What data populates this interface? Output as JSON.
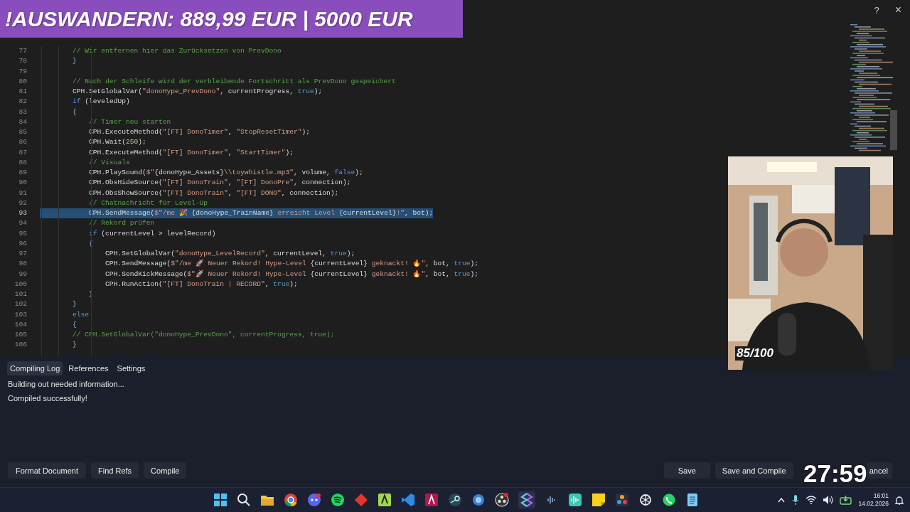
{
  "overlay": {
    "banner": "!AUSWANDERN: 889,99 EUR | 5000 EUR",
    "timer": "27:59",
    "webcam_counter": "85/100"
  },
  "window": {
    "help": "?",
    "close": "×"
  },
  "editor": {
    "lines": [
      {
        "number": "77",
        "selected": false,
        "tokens": [
          {
            "kind": "comment",
            "text": "        // Wir entfernen hier das Zurücksetzen von PrevDono"
          }
        ]
      },
      {
        "number": "78",
        "selected": false,
        "tokens": [
          {
            "kind": "brace",
            "text": "        }"
          }
        ]
      },
      {
        "number": "79",
        "selected": false
      },
      {
        "number": "80",
        "selected": false,
        "tokens": [
          {
            "kind": "comment",
            "text": "        // Nach der Schleife wird der verbleibende Fortschritt als PrevDono gespeichert"
          }
        ]
      },
      {
        "number": "81",
        "selected": false,
        "tokens": [
          {
            "kind": "plain",
            "text": "        CPH.SetGlobalVar("
          },
          {
            "kind": "string",
            "text": "\"donoHype_PrevDono\""
          },
          {
            "kind": "plain",
            "text": ", currentProgress, "
          },
          {
            "kind": "keyword",
            "text": "true"
          },
          {
            "kind": "plain",
            "text": ");"
          }
        ]
      },
      {
        "number": "82",
        "selected": false,
        "tokens": [
          {
            "kind": "keyword",
            "text": "        if"
          },
          {
            "kind": "plain",
            "text": " (leveledUp)"
          }
        ]
      },
      {
        "number": "83",
        "selected": false,
        "tokens": [
          {
            "kind": "brace",
            "text": "        {"
          }
        ]
      },
      {
        "number": "84",
        "selected": false,
        "tokens": [
          {
            "kind": "comment",
            "text": "            // Timer neu starten"
          }
        ]
      },
      {
        "number": "85",
        "selected": false,
        "tokens": [
          {
            "kind": "plain",
            "text": "            CPH.ExecuteMethod("
          },
          {
            "kind": "string",
            "text": "\"[FT] DonoTimer\""
          },
          {
            "kind": "plain",
            "text": ", "
          },
          {
            "kind": "string",
            "text": "\"StopResetTimer\""
          },
          {
            "kind": "plain",
            "text": ");"
          }
        ]
      },
      {
        "number": "86",
        "selected": false,
        "tokens": [
          {
            "kind": "plain",
            "text": "            CPH.Wait("
          },
          {
            "kind": "number",
            "text": "250"
          },
          {
            "kind": "plain",
            "text": ");"
          }
        ]
      },
      {
        "number": "87",
        "selected": false,
        "tokens": [
          {
            "kind": "plain",
            "text": "            CPH.ExecuteMethod("
          },
          {
            "kind": "string",
            "text": "\"[FT] DonoTimer\""
          },
          {
            "kind": "plain",
            "text": ", "
          },
          {
            "kind": "string",
            "text": "\"StartTimer\""
          },
          {
            "kind": "plain",
            "text": ");"
          }
        ]
      },
      {
        "number": "88",
        "selected": false,
        "tokens": [
          {
            "kind": "comment",
            "text": "            // Visuals"
          }
        ]
      },
      {
        "number": "89",
        "selected": false,
        "tokens": [
          {
            "kind": "plain",
            "text": "            CPH.PlaySound("
          },
          {
            "kind": "string",
            "text": "$\""
          },
          {
            "kind": "plain",
            "text": "{donoHype_Assets}"
          },
          {
            "kind": "string",
            "text": "\\\\toywhistle.mp3\""
          },
          {
            "kind": "plain",
            "text": ", volume, "
          },
          {
            "kind": "keyword",
            "text": "false"
          },
          {
            "kind": "plain",
            "text": ");"
          }
        ]
      },
      {
        "number": "90",
        "selected": false,
        "tokens": [
          {
            "kind": "plain",
            "text": "            CPH.ObsHideSource("
          },
          {
            "kind": "string",
            "text": "\"[FT] DonoTrain\""
          },
          {
            "kind": "plain",
            "text": ", "
          },
          {
            "kind": "string",
            "text": "\"[FT] DonoPre\""
          },
          {
            "kind": "plain",
            "text": ", connection);"
          }
        ]
      },
      {
        "number": "91",
        "selected": false,
        "tokens": [
          {
            "kind": "plain",
            "text": "            CPH.ObsShowSource("
          },
          {
            "kind": "string",
            "text": "\"[FT] DonoTrain\""
          },
          {
            "kind": "plain",
            "text": ", "
          },
          {
            "kind": "string",
            "text": "\"[FT] DONO\""
          },
          {
            "kind": "plain",
            "text": ", connection);"
          }
        ]
      },
      {
        "number": "92",
        "selected": false,
        "tokens": [
          {
            "kind": "comment",
            "text": "            // Chatnachricht für Level-Up"
          }
        ]
      },
      {
        "number": "93",
        "selected": true,
        "tokens": [
          {
            "kind": "plain",
            "text": "            CPH.SendMessage("
          },
          {
            "kind": "string",
            "text": "$\"/me 🎉 "
          },
          {
            "kind": "plain",
            "text": "{donoHype_TrainName}"
          },
          {
            "kind": "string",
            "text": " erreicht Level "
          },
          {
            "kind": "plain",
            "text": "{currentLevel}"
          },
          {
            "kind": "string",
            "text": "!\""
          },
          {
            "kind": "plain",
            "text": ", bot);"
          }
        ]
      },
      {
        "number": "94",
        "selected": false,
        "tokens": [
          {
            "kind": "comment",
            "text": "            // Rekord prüfen"
          }
        ]
      },
      {
        "number": "95",
        "selected": false,
        "tokens": [
          {
            "kind": "keyword",
            "text": "            if"
          },
          {
            "kind": "plain",
            "text": " (currentLevel > levelRecord)"
          }
        ]
      },
      {
        "number": "96",
        "selected": false,
        "tokens": [
          {
            "kind": "brace",
            "text": "            {"
          }
        ]
      },
      {
        "number": "97",
        "selected": false,
        "tokens": [
          {
            "kind": "plain",
            "text": "                CPH.SetGlobalVar("
          },
          {
            "kind": "string",
            "text": "\"donoHype_LevelRecord\""
          },
          {
            "kind": "plain",
            "text": ", currentLevel, "
          },
          {
            "kind": "keyword",
            "text": "true"
          },
          {
            "kind": "plain",
            "text": ");"
          }
        ]
      },
      {
        "number": "98",
        "selected": false,
        "tokens": [
          {
            "kind": "plain",
            "text": "                CPH.SendMessage("
          },
          {
            "kind": "string",
            "text": "$\"/me 🚀 Neuer Rekord! Hype-Level "
          },
          {
            "kind": "plain",
            "text": "{currentLevel}"
          },
          {
            "kind": "string",
            "text": " geknackt! 🔥\""
          },
          {
            "kind": "plain",
            "text": ", bot, "
          },
          {
            "kind": "keyword",
            "text": "true"
          },
          {
            "kind": "plain",
            "text": ");"
          }
        ]
      },
      {
        "number": "99",
        "selected": false,
        "tokens": [
          {
            "kind": "plain",
            "text": "                CPH.SendKickMessage("
          },
          {
            "kind": "string",
            "text": "$\"🚀 Neuer Rekord! Hype-Level "
          },
          {
            "kind": "plain",
            "text": "{currentLevel}"
          },
          {
            "kind": "string",
            "text": " geknackt! 🔥\""
          },
          {
            "kind": "plain",
            "text": ", bot, "
          },
          {
            "kind": "keyword",
            "text": "true"
          },
          {
            "kind": "plain",
            "text": ");"
          }
        ]
      },
      {
        "number": "100",
        "selected": false,
        "tokens": [
          {
            "kind": "plain",
            "text": "                CPH.RunAction("
          },
          {
            "kind": "string",
            "text": "\"[FT] DonoTrain | RECORD\""
          },
          {
            "kind": "plain",
            "text": ", "
          },
          {
            "kind": "keyword",
            "text": "true"
          },
          {
            "kind": "plain",
            "text": ");"
          }
        ]
      },
      {
        "number": "101",
        "selected": false,
        "tokens": [
          {
            "kind": "brace",
            "text": "            }"
          }
        ]
      },
      {
        "number": "102",
        "selected": false,
        "tokens": [
          {
            "kind": "brace",
            "text": "        }"
          }
        ]
      },
      {
        "number": "103",
        "selected": false,
        "tokens": [
          {
            "kind": "keyword",
            "text": "        else"
          }
        ]
      },
      {
        "number": "104",
        "selected": false,
        "tokens": [
          {
            "kind": "brace",
            "text": "        {"
          }
        ]
      },
      {
        "number": "105",
        "selected": false,
        "tokens": [
          {
            "kind": "comment",
            "text": "        // CPH.SetGlobalVar(\"donoHype_PrevDono\", currentProgress, true);"
          }
        ]
      },
      {
        "number": "106",
        "selected": false,
        "tokens": [
          {
            "kind": "brace",
            "text": "        }"
          }
        ]
      }
    ]
  },
  "panel": {
    "tabs": [
      {
        "label": "Compiling Log",
        "selected": true
      },
      {
        "label": "References",
        "selected": false
      },
      {
        "label": "Settings",
        "selected": false
      }
    ],
    "log": [
      "Building out needed information...",
      "Compiled successfully!"
    ],
    "left_buttons": [
      "Format Document",
      "Find Refs",
      "Compile"
    ],
    "right_buttons": [
      "Save",
      "Save and Compile",
      "ancel"
    ]
  },
  "taskbar": {
    "time": "16:01",
    "date": "14.02.2026"
  }
}
